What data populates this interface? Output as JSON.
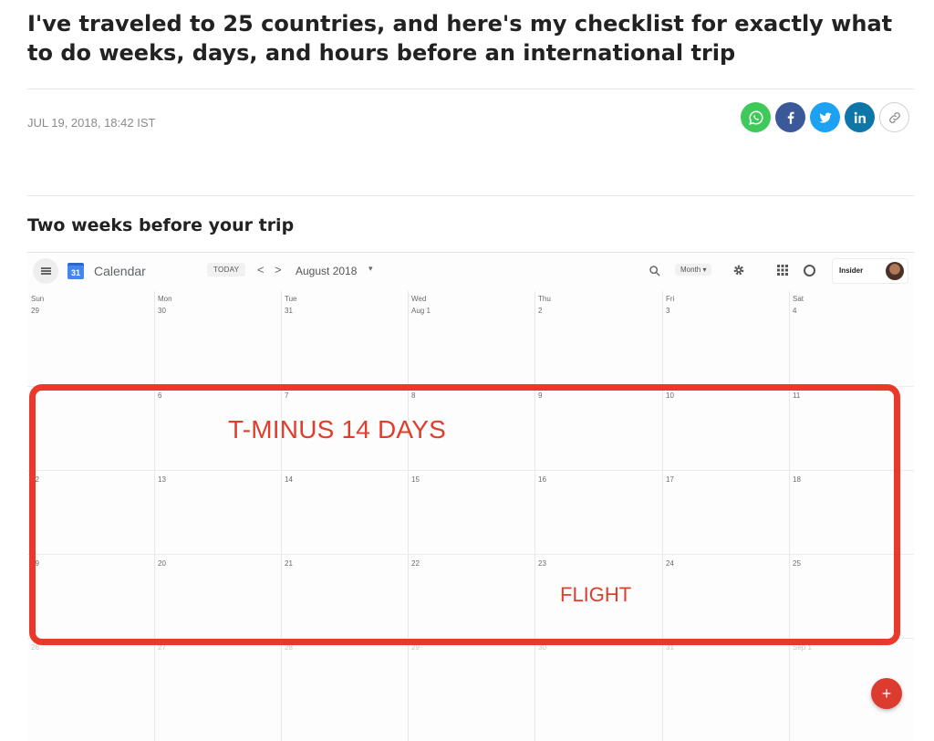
{
  "article": {
    "headline": "I've traveled to 25 countries, and here's my checklist for exactly what to do weeks, days, and hours before an international trip",
    "dateline": "JUL 19, 2018, 18:42 IST",
    "section_heading": "Two weeks before your trip"
  },
  "share": [
    {
      "icon": "whatsapp-icon",
      "color": "#3ec95a"
    },
    {
      "icon": "facebook-icon",
      "color": "#3b5998"
    },
    {
      "icon": "twitter-icon",
      "color": "#1da1f2"
    },
    {
      "icon": "linkedin-icon",
      "color": "#0e76a8"
    },
    {
      "icon": "link-icon",
      "color": "#ffffff"
    }
  ],
  "calendar": {
    "app_title": "Calendar",
    "logo_day": "31",
    "today_label": "TODAY",
    "prev_symbol": "<",
    "next_symbol": ">",
    "month_label": "August 2018",
    "view_label": "Month",
    "account_label": "Insider",
    "weekdays": [
      "Sun",
      "Mon",
      "Tue",
      "Wed",
      "Thu",
      "Fri",
      "Sat"
    ],
    "weeks": [
      [
        "29",
        "30",
        "31",
        "Aug 1",
        "2",
        "3",
        "4"
      ],
      [
        "5",
        "6",
        "7",
        "8",
        "9",
        "10",
        "11"
      ],
      [
        "12",
        "13",
        "14",
        "15",
        "16",
        "17",
        "18"
      ],
      [
        "19",
        "20",
        "21",
        "22",
        "23",
        "24",
        "25"
      ],
      [
        "26",
        "27",
        "28",
        "29",
        "30",
        "31",
        "Sep 1"
      ]
    ],
    "annotation_main": "T-MINUS 14 DAYS",
    "annotation_flight": "FLIGHT",
    "annotation_color": "#e8392a",
    "fab_label": "+"
  }
}
